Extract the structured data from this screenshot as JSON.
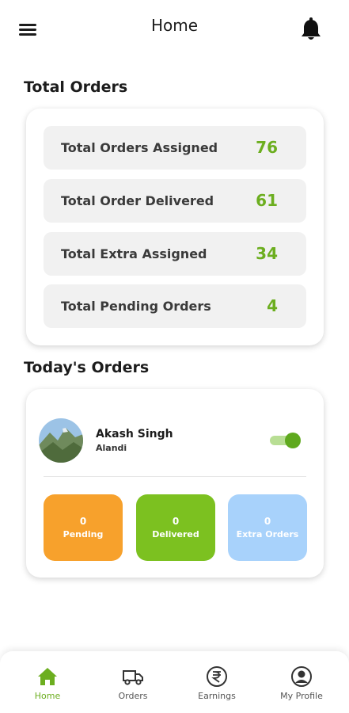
{
  "app_bar": {
    "title": "Home"
  },
  "sections": {
    "total_orders": "Total Orders",
    "todays_orders": "Today's Orders"
  },
  "stats": [
    {
      "label": "Total Orders Assigned",
      "value": "76"
    },
    {
      "label": "Total Order Delivered",
      "value": "61"
    },
    {
      "label": "Total Extra Assigned",
      "value": "34"
    },
    {
      "label": "Total Pending Orders",
      "value": "4"
    }
  ],
  "today": {
    "user": {
      "name": "Akash Singh",
      "location": "Alandi"
    },
    "availability_on": true,
    "tiles": [
      {
        "count": "0",
        "label": "Pending",
        "color": "#f7a12c"
      },
      {
        "count": "0",
        "label": "Delivered",
        "color": "#7cc120"
      },
      {
        "count": "0",
        "label": "Extra Orders",
        "color": "#a8d2fb"
      }
    ]
  },
  "nav": [
    {
      "label": "Home",
      "icon": "home-icon",
      "active": true
    },
    {
      "label": "Orders",
      "icon": "truck-icon",
      "active": false
    },
    {
      "label": "Earnings",
      "icon": "rupee-icon",
      "active": false
    },
    {
      "label": "My Profile",
      "icon": "profile-icon",
      "active": false
    }
  ],
  "colors": {
    "accent": "#6cae1f",
    "stat_bg": "#f1f1f1"
  }
}
